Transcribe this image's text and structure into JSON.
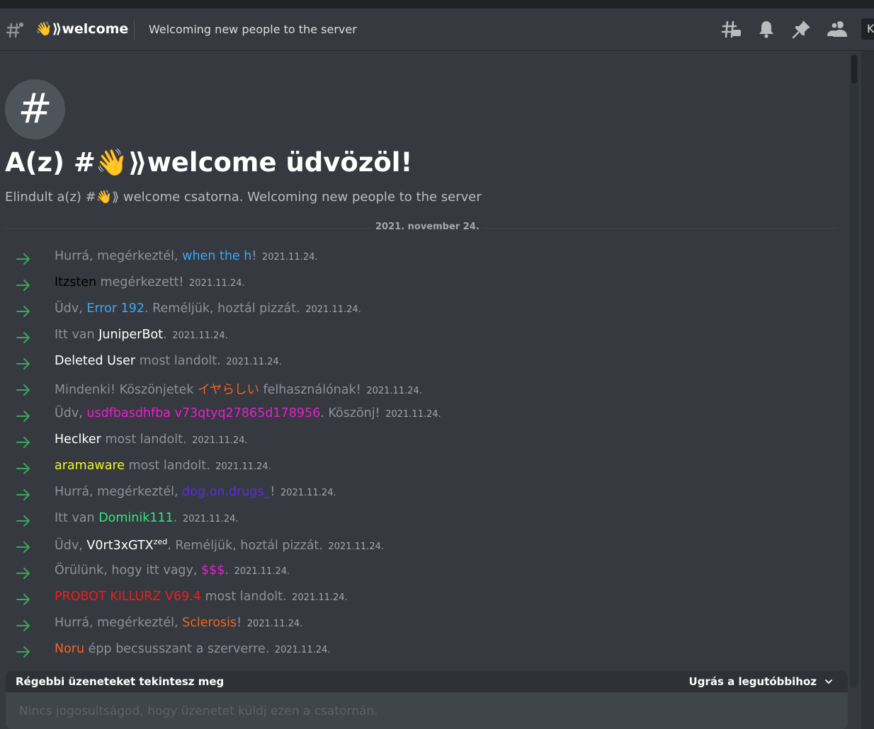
{
  "header": {
    "channel_name": "👋⟫welcome",
    "topic": "Welcoming new people to the server",
    "search_initial": "K",
    "icons": [
      "threads-icon",
      "bell-icon",
      "pin-icon",
      "members-icon"
    ]
  },
  "intro": {
    "title": "A(z) #👋⟫welcome üdvözöl!",
    "description": "Elindult a(z) #👋⟫ welcome csatorna. Welcoming new people to the server"
  },
  "divider": {
    "date": "2021. november 24."
  },
  "messages": [
    {
      "pre": "Hurrá, megérkeztél, ",
      "user": "when the h",
      "post": "!",
      "color": "#3ba8f5",
      "ts": "2021.11.24."
    },
    {
      "pre": "",
      "user": "Itzsten",
      "post": " megérkezett!",
      "color": "#000000",
      "ts": "2021.11.24."
    },
    {
      "pre": "Üdv, ",
      "user": "Error 192",
      "post": ". Reméljük, hoztál pizzát.",
      "color": "#3ba8f5",
      "ts": "2021.11.24."
    },
    {
      "pre": "Itt van ",
      "user": "JuniperBot",
      "post": ".",
      "color": "#ffffff",
      "ts": "2021.11.24."
    },
    {
      "pre": "",
      "user": "Deleted User",
      "post": " most landolt.",
      "color": "#ffffff",
      "ts": "2021.11.24."
    },
    {
      "pre": "Mindenki! Köszönjetek ",
      "user": "イヤらしい",
      "post": " felhasználónak!",
      "color": "#f26522",
      "ts": "2021.11.24."
    },
    {
      "pre": "Üdv, ",
      "user": "usdfbasdhfba v73qtyq27865d178956",
      "post": ". Köszönj!",
      "color": "#e91ed2",
      "ts": "2021.11.24."
    },
    {
      "pre": "",
      "user": "Heclker",
      "post": " most landolt.",
      "color": "#ffffff",
      "ts": "2021.11.24."
    },
    {
      "pre": "",
      "user": "aramaware",
      "post": " most landolt.",
      "color": "#f1f52d",
      "ts": "2021.11.24."
    },
    {
      "pre": "Hurrá, megérkeztél, ",
      "user": "dog.on.drugs_",
      "post": "!",
      "color": "#5b2ee8",
      "ts": "2021.11.24."
    },
    {
      "pre": "Itt van ",
      "user": "Dominik111",
      "post": ".",
      "color": "#2ee87a",
      "ts": "2021.11.24."
    },
    {
      "pre": "Üdv, ",
      "user": "V0rt3xGTX",
      "user_sup": "zed",
      "post": ". Reméljük, hoztál pizzát.",
      "color": "#ffffff",
      "ts": "2021.11.24."
    },
    {
      "pre": "Örülünk, hogy itt vagy, ",
      "user": "$$$",
      "post": ".",
      "color": "#e91ed2",
      "ts": "2021.11.24."
    },
    {
      "pre": "",
      "user": "PROBOT KILLURZ V69.4",
      "post": " most landolt.",
      "color": "#f01d1d",
      "ts": "2021.11.24."
    },
    {
      "pre": "Hurrá, megérkeztél, ",
      "user": "Sclerosis",
      "post": "!",
      "color": "#f26522",
      "ts": "2021.11.24."
    },
    {
      "pre": "",
      "user": "Noru",
      "post": " épp becsusszant a szerverre.",
      "color": "#f26522",
      "ts": "2021.11.24."
    }
  ],
  "older_bar": {
    "label": "Régebbi üzeneteket tekintesz meg",
    "jump_label": "Ugrás a legutóbbihoz"
  },
  "composer": {
    "placeholder": "Nincs jogosultságod, hogy üzenetet küldj ezen a csatornán."
  },
  "colors": {
    "background": "#36393f",
    "arrow": "#3ba55d"
  }
}
